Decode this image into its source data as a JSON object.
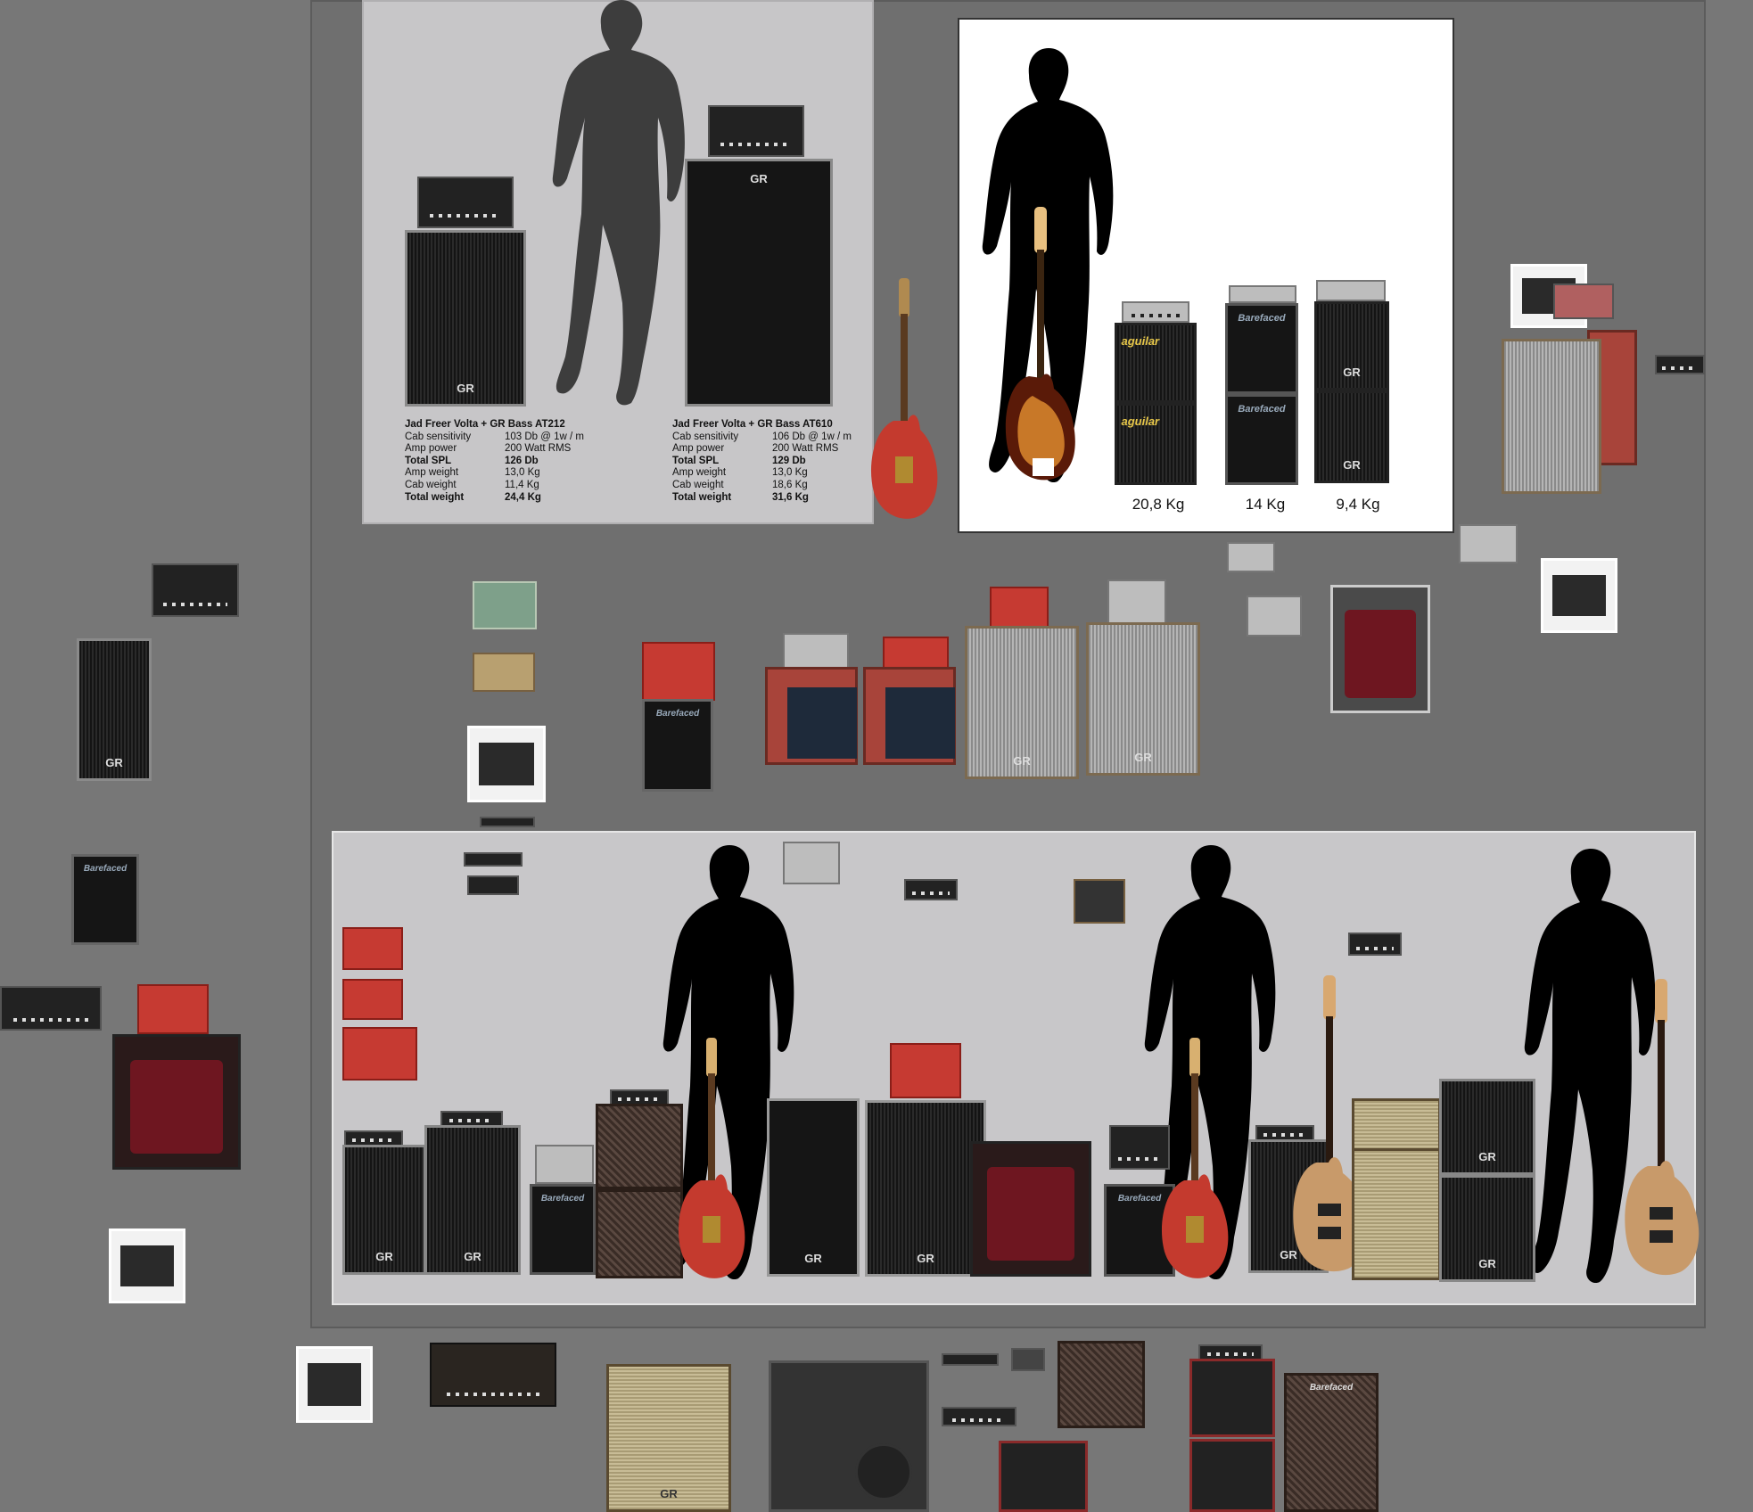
{
  "panel_a": {
    "left_spec": {
      "title": "Jad Freer Volta + GR Bass AT212",
      "rows": [
        {
          "label": "Cab sensitivity",
          "value": "103  Db @ 1w / m",
          "bold": false
        },
        {
          "label": "Amp power",
          "value": "200  Watt RMS",
          "bold": false
        },
        {
          "label": "Total SPL",
          "value": "126  Db",
          "bold": true
        },
        {
          "label": "Amp weight",
          "value": "13,0  Kg",
          "bold": false
        },
        {
          "label": "Cab weight",
          "value": "11,4  Kg",
          "bold": false
        },
        {
          "label": "Total weight",
          "value": "24,4  Kg",
          "bold": true
        }
      ]
    },
    "right_spec": {
      "title": "Jad Freer Volta + GR Bass AT610",
      "rows": [
        {
          "label": "Cab sensitivity",
          "value": "106  Db @ 1w / m",
          "bold": false
        },
        {
          "label": "Amp power",
          "value": "200  Watt RMS",
          "bold": false
        },
        {
          "label": "Total SPL",
          "value": "129  Db",
          "bold": true
        },
        {
          "label": "Amp weight",
          "value": "13,0  Kg",
          "bold": false
        },
        {
          "label": "Cab weight",
          "value": "18,6  Kg",
          "bold": false
        },
        {
          "label": "Total weight",
          "value": "31,6  Kg",
          "bold": true
        }
      ]
    }
  },
  "panel_b": {
    "weights": [
      "20,8 Kg",
      "14 Kg",
      "9,4 Kg"
    ]
  },
  "brands": {
    "gr": "GR",
    "aguilar": "aguilar",
    "barefaced": "Barefaced"
  },
  "colors": {
    "canvas": "#777777",
    "artboard": "#6f6f6f",
    "panel_grey": "#c7c6c8",
    "panel_white": "#ffffff"
  }
}
